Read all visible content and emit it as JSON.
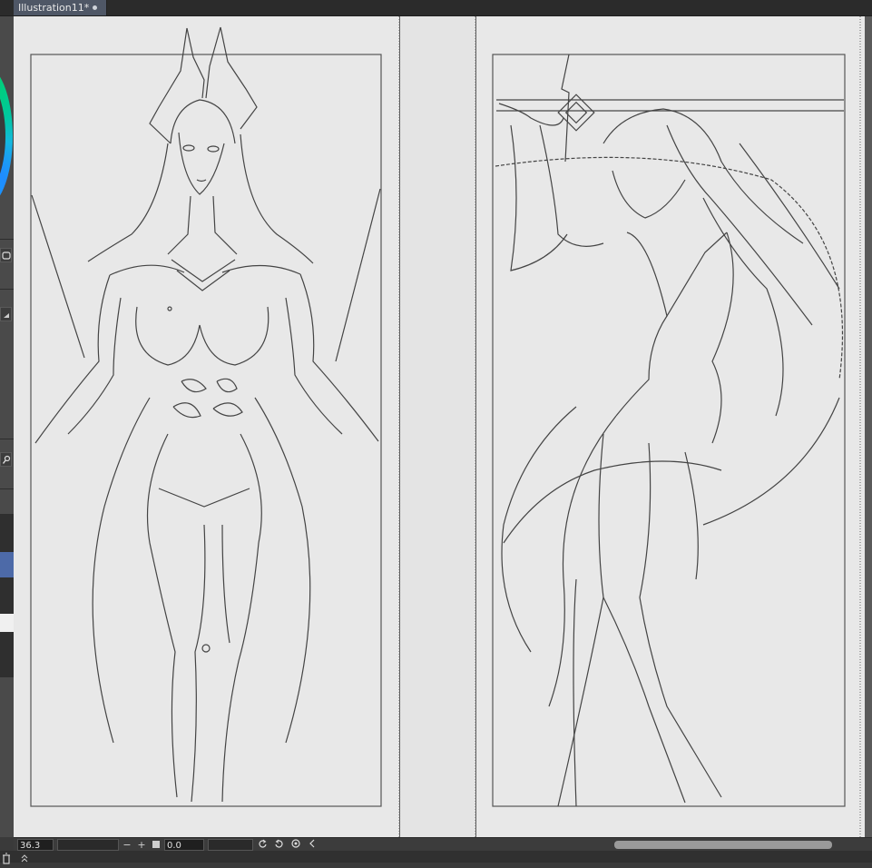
{
  "document": {
    "tab_title": "Illustration11*"
  },
  "status_bar": {
    "zoom_value": "36.3",
    "rotation_value": "0.0",
    "zoom_out_symbol": "−",
    "zoom_in_symbol": "+",
    "undo_icon": "rotate-left-icon",
    "redo_icon": "rotate-right-icon",
    "reset_icon": "reset-rotation-icon",
    "collapse_icon": "chevron-left-icon"
  },
  "left_panel": {
    "color_wheel": "color-wheel",
    "icons": [
      "layer-icon",
      "fill-bucket-icon",
      "wrench-icon"
    ],
    "accent_colors": [
      "#00d26a",
      "#1f8cff"
    ]
  },
  "bottom": {
    "icons": [
      "trash-icon",
      "expand-icon"
    ]
  },
  "theme": {
    "tab_active": "#4f5766",
    "canvas_background": "#5a5a5a",
    "paper": "#e6e6e6"
  }
}
